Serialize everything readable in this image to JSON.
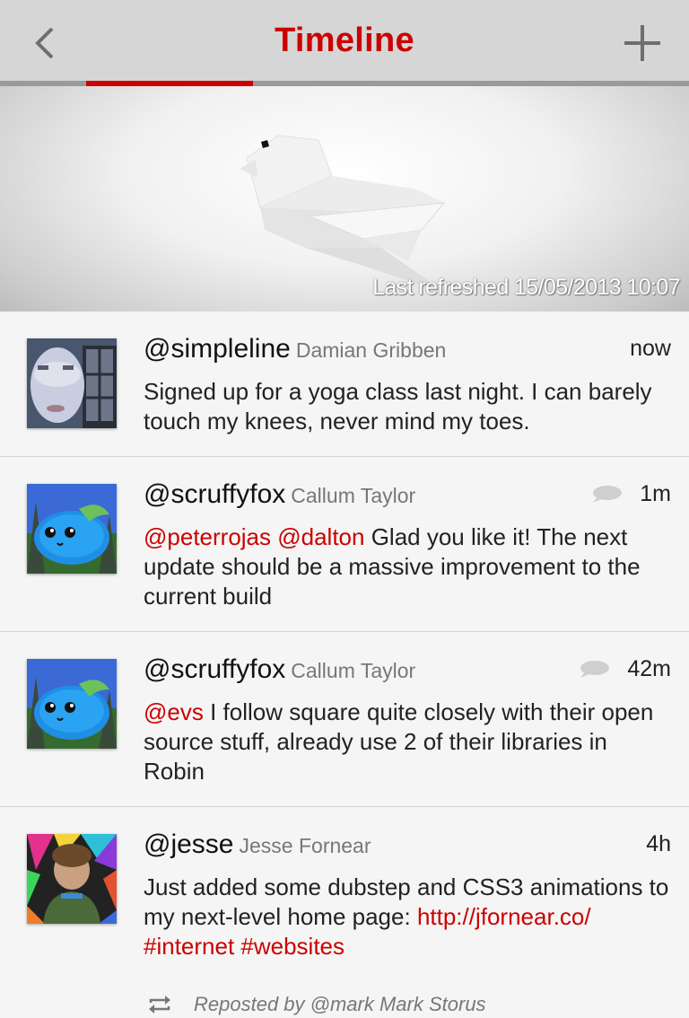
{
  "header": {
    "title": "Timeline",
    "accent_color": "#cc0000",
    "back_icon": "chevron-left-icon",
    "add_icon": "plus-icon"
  },
  "hero": {
    "last_refreshed": "Last refreshed 15/05/2013 10:07"
  },
  "tweets": [
    {
      "handle": "@simpleline",
      "name": "Damian Gribben",
      "time": "now",
      "has_reply_icon": false,
      "mentions": "",
      "text": "Signed up for a yoga class last night. I can barely touch my knees, never mind my toes."
    },
    {
      "handle": "@scruffyfox",
      "name": "Callum Taylor",
      "time": "1m",
      "has_reply_icon": true,
      "mentions": "@peterrojas @dalton",
      "text": " Glad you like it! The next update should be a massive improvement to the current build"
    },
    {
      "handle": "@scruffyfox",
      "name": "Callum Taylor",
      "time": "42m",
      "has_reply_icon": true,
      "mentions": "@evs",
      "text": " I follow square quite closely with their open source stuff, already use 2 of their libraries in Robin"
    },
    {
      "handle": "@jesse",
      "name": "Jesse Fornear",
      "time": "4h",
      "has_reply_icon": false,
      "text_plain": "Just added some dubstep and CSS3 animations to my next-level home page: ",
      "link": "http://jfornear.co/ #internet #websites"
    }
  ],
  "repost": {
    "label": "Reposted by @mark Mark Storus"
  }
}
